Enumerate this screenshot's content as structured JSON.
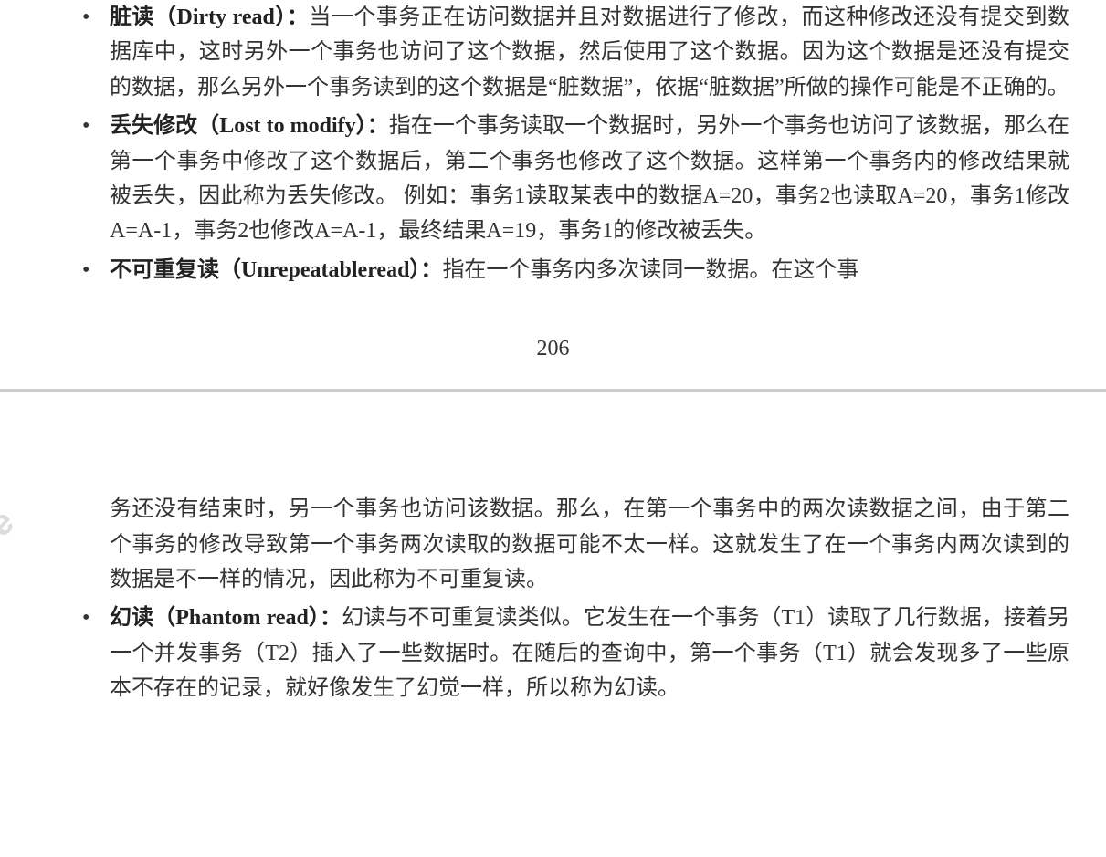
{
  "page1": {
    "items": [
      {
        "term": "脏读（Dirty read）：",
        "body": "当一个事务正在访问数据并且对数据进行了修改，而这种修改还没有提交到数据库中，这时另外一个事务也访问了这个数据，然后使用了这个数据。因为这个数据是还没有提交的数据，那么另外一个事务读到的这个数据是“脏数据”，依据“脏数据”所做的操作可能是不正确的。"
      },
      {
        "term": "丢失修改（Lost to modify）：",
        "body": "指在一个事务读取一个数据时，另外一个事务也访问了该数据，那么在第一个事务中修改了这个数据后，第二个事务也修改了这个数据。这样第一个事务内的修改结果就被丢失，因此称为丢失修改。 例如：事务1读取某表中的数据A=20，事务2也读取A=20，事务1修改A=A-1，事务2也修改A=A-1，最终结果A=19，事务1的修改被丢失。"
      },
      {
        "term": "不可重复读（Unrepeatableread）：",
        "body": "指在一个事务内多次读同一数据。在这个事"
      }
    ],
    "pageNumber": "206"
  },
  "page2": {
    "continuation": "务还没有结束时，另一个事务也访问该数据。那么，在第一个事务中的两次读数据之间，由于第二个事务的修改导致第一个事务两次读取的数据可能不太一样。这就发生了在一个事务内两次读到的数据是不一样的情况，因此称为不可重复读。",
    "items": [
      {
        "term": "幻读（Phantom read）：",
        "body": "幻读与不可重复读类似。它发生在一个事务（T1）读取了几行数据，接着另一个并发事务（T2）插入了一些数据时。在随后的查询中，第一个事务（T1）就会发现多了一些原本不存在的记录，就好像发生了幻觉一样，所以称为幻读。"
      }
    ]
  },
  "watermark": "e"
}
